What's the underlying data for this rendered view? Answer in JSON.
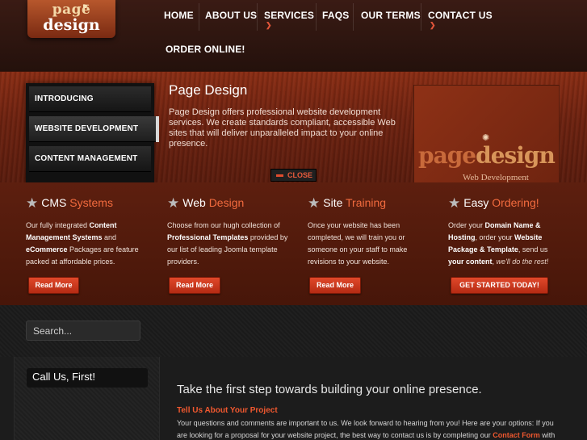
{
  "logo": {
    "line1": "page",
    "line2": "design",
    "alt": "Page Design logo"
  },
  "nav": {
    "home": "HOME",
    "about": "ABOUT US",
    "services": "SERVICES",
    "faqs": "FAQS",
    "terms": "OUR TERMS",
    "contact": "CONTACT US",
    "order": "ORDER ONLINE!"
  },
  "slider": {
    "tabs": [
      "INTRODUCING",
      "WEBSITE DEVELOPMENT",
      "CONTENT MANAGEMENT"
    ],
    "active_tab": "WEBSITE DEVELOPMENT",
    "title": "Page Design",
    "text": "Page Design offers professional website development services. We create standards compliant, accessible Web sites that will deliver unparalleled impact to your online presence.",
    "image": {
      "brand_a": "page",
      "brand_b": "design",
      "caption": "Web Development"
    },
    "close_label": "CLOSE"
  },
  "features": [
    {
      "title_a": "CMS",
      "title_b": "Systems",
      "t1": "Our fully integrated ",
      "b1": "Content Management Systems",
      "t2": " and ",
      "b2": "eCommerce",
      "t3": " Packages are feature packed at affordable prices.",
      "button": "Read More"
    },
    {
      "title_a": "Web",
      "title_b": "Design",
      "t1": "Choose from our hugh collection of ",
      "b1": "Professional Templates",
      "t2": " provided by our list of leading Joomla template providers.",
      "button": "Read More"
    },
    {
      "title_a": "Site",
      "title_b": "Training",
      "t1": "Once your website has been completed, we will train you or someone on your staff to make revisions to your website.",
      "button": "Read More"
    },
    {
      "title_a": "Easy",
      "title_b": "Ordering!",
      "t1": "Order your ",
      "b1": "Domain Name & Hosting",
      "t2": ", order your ",
      "b2": "Website Package & Template",
      "t3": ", send us ",
      "b3": "your content",
      "t4": ", ",
      "i1": "we'll do the rest!",
      "button": "GET STARTED TODAY!"
    }
  ],
  "search": {
    "placeholder": "Search..."
  },
  "sidebar": {
    "call_label": "Call Us, First!"
  },
  "main": {
    "heading": "Take the first step towards building your online presence.",
    "subheading": "Tell Us About Your Project",
    "text_1": "Your questions and comments are important to us. We look forward to hearing from you! Here are your options: If you are looking for a proposal for your website project, the best way to contact us is by completing our ",
    "link": "Contact Form",
    "text_2": " with your"
  },
  "colors": {
    "accent": "#f0582f",
    "button_red": "#c7361b",
    "header_bg": "#2e150f",
    "slider_bg": "#6d2210",
    "features_bg": "#521b0c",
    "dark_bg": "#1c1c1c"
  },
  "icons": [
    "star-icon",
    "chevron-down-icon",
    "minus-icon"
  ]
}
